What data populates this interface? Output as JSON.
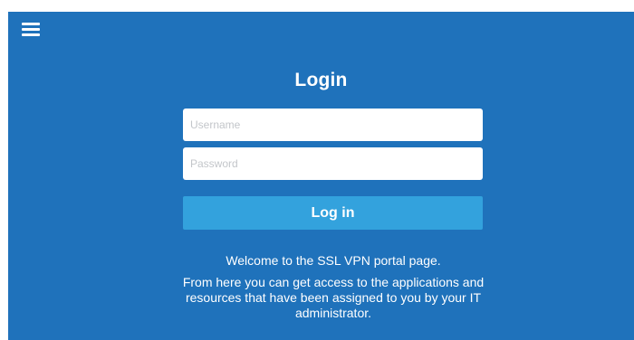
{
  "header": {
    "menu_icon": "hamburger-menu-icon"
  },
  "login": {
    "title": "Login",
    "username_placeholder": "Username",
    "password_placeholder": "Password",
    "submit_label": "Log in"
  },
  "messages": {
    "welcome": "Welcome to the SSL VPN portal page.",
    "info": "From here you can get access to the applications and resources that have been assigned to you by your IT administrator."
  },
  "colors": {
    "background": "#1f72bb",
    "button": "#33a2dd",
    "text": "#ffffff"
  }
}
